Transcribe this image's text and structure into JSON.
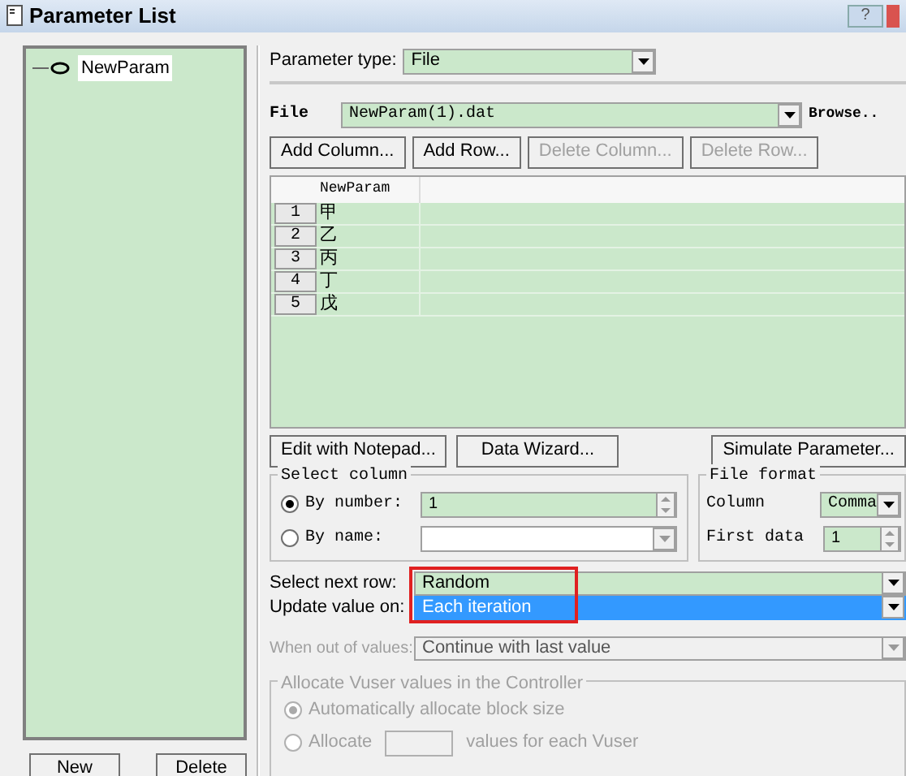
{
  "window": {
    "title": "Parameter List",
    "help_button": "?"
  },
  "tree": {
    "items": [
      {
        "label": "NewParam",
        "selected": true
      }
    ]
  },
  "left_buttons": [
    "New",
    "Delete"
  ],
  "parameter_type": {
    "label": "Parameter type:",
    "value": "File"
  },
  "file": {
    "label": "File",
    "value": "NewParam(1).dat",
    "browse": "Browse.."
  },
  "table_buttons": [
    {
      "label": "Add Column...",
      "disabled": false
    },
    {
      "label": "Add Row...",
      "disabled": false
    },
    {
      "label": "Delete Column...",
      "disabled": true
    },
    {
      "label": "Delete Row...",
      "disabled": true
    }
  ],
  "table": {
    "columns": [
      "NewParam"
    ],
    "rows": [
      {
        "index": "1",
        "cells": [
          "甲"
        ]
      },
      {
        "index": "2",
        "cells": [
          "乙"
        ]
      },
      {
        "index": "3",
        "cells": [
          "丙"
        ]
      },
      {
        "index": "4",
        "cells": [
          "丁"
        ]
      },
      {
        "index": "5",
        "cells": [
          "戊"
        ]
      }
    ]
  },
  "lower_buttons": [
    "Edit with Notepad...",
    "Data Wizard...",
    "Simulate Parameter..."
  ],
  "select_column": {
    "title": "Select column",
    "options": [
      {
        "label": "By number:",
        "selected": true,
        "value": "1"
      },
      {
        "label": "By name:",
        "selected": false
      }
    ]
  },
  "file_format": {
    "title": "File format",
    "column_label": "Column",
    "column_value": "Comma",
    "first_data_label": "First data",
    "first_data_value": "1"
  },
  "select_next_row": {
    "label": "Select next row:",
    "value": "Random",
    "highlighted": false
  },
  "update_value_on": {
    "label": "Update value on:",
    "value": "Each iteration",
    "highlighted": true
  },
  "when_out_of_values": {
    "label": "When out of values:",
    "value": "Continue with last value",
    "disabled": true
  },
  "allocate": {
    "title": "Allocate Vuser values in the Controller",
    "disabled": true,
    "options": [
      {
        "kind": "auto",
        "label": "Automatically allocate block size",
        "selected": true
      },
      {
        "kind": "count",
        "label": "Allocate",
        "suffix": "values for each Vuser",
        "selected": false
      }
    ]
  }
}
